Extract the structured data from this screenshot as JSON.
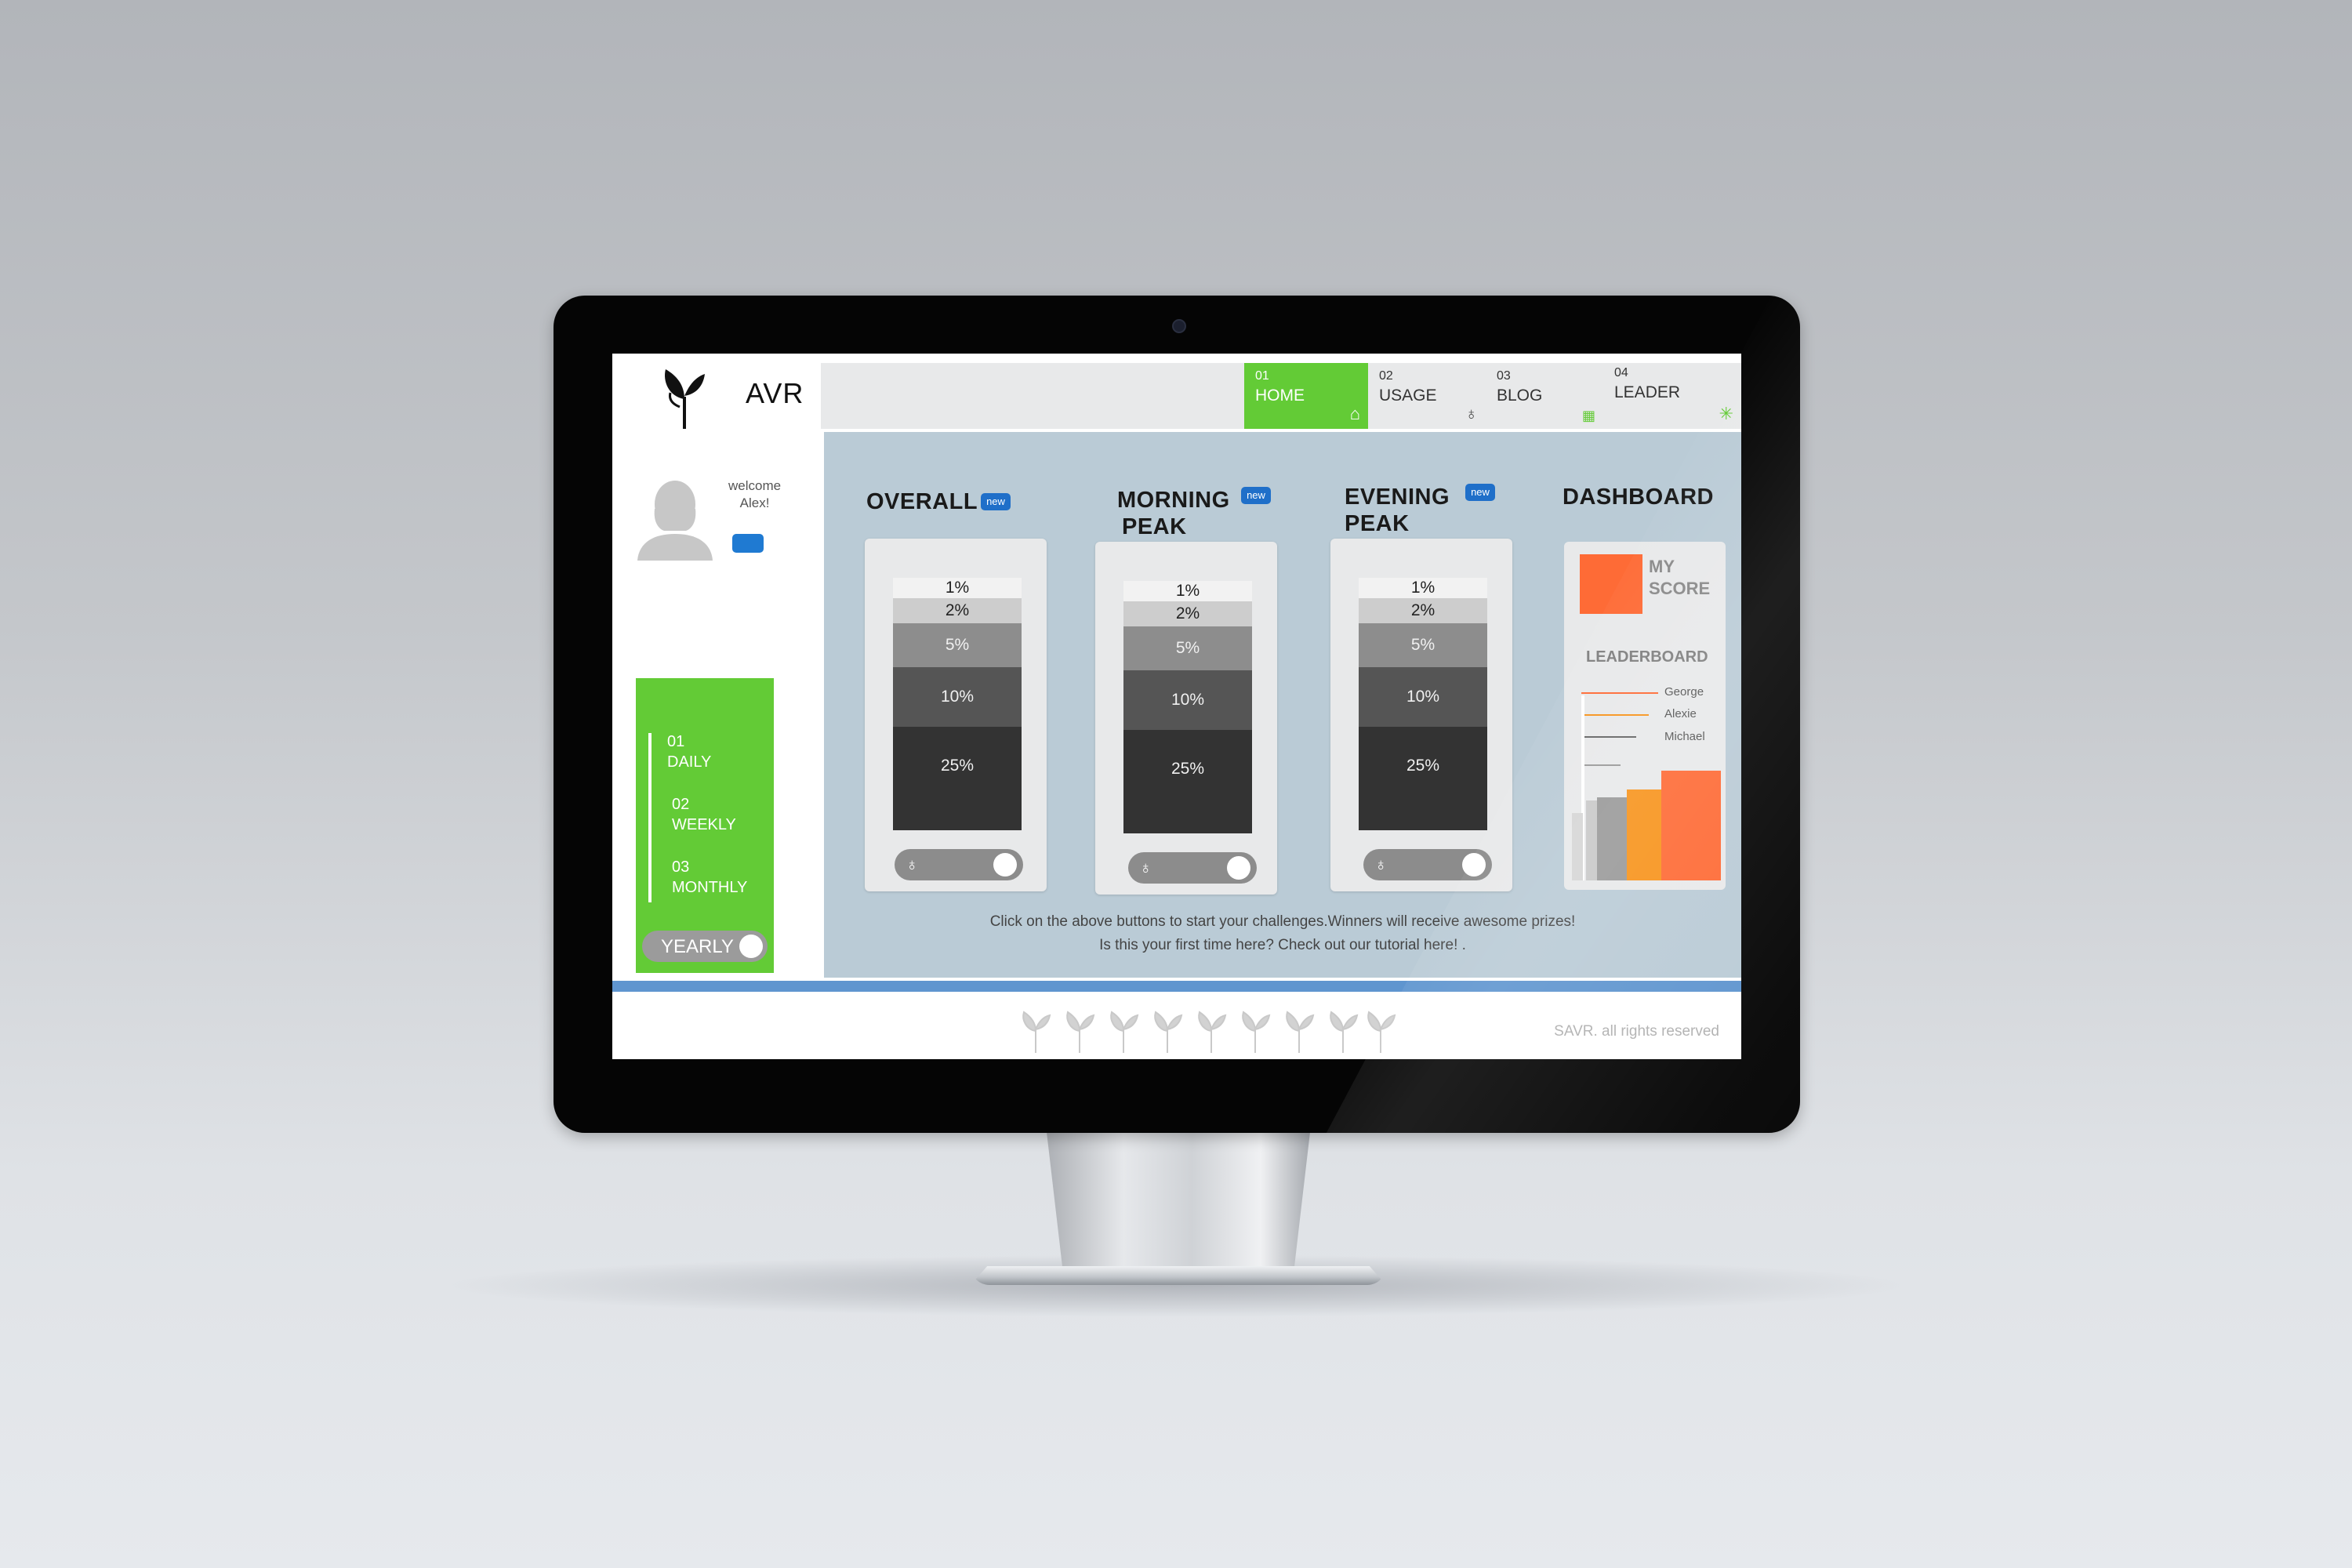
{
  "app": {
    "logo_text": "AVR"
  },
  "nav": {
    "items": [
      {
        "num": "01",
        "label": "HOME"
      },
      {
        "num": "02",
        "label": "USAGE"
      },
      {
        "num": "03",
        "label": "BLOG"
      },
      {
        "num": "04",
        "label": "LEADER"
      }
    ],
    "active": "HOME"
  },
  "user": {
    "welcome": "welcome",
    "name": "Alex!"
  },
  "periods": [
    {
      "num": "01",
      "label": "DAILY"
    },
    {
      "num": "02",
      "label": "WEEKLY"
    },
    {
      "num": "03",
      "label": "MONTHLY"
    }
  ],
  "yearly_label": "YEARLY",
  "challenges": [
    {
      "title_line1": "OVERALL",
      "title_line2": "",
      "badge": "new",
      "levels": [
        "1%",
        "2%",
        "5%",
        "10%",
        "25%"
      ]
    },
    {
      "title_line1": "MORNING",
      "title_line2": "PEAK",
      "badge": "new",
      "levels": [
        "1%",
        "2%",
        "5%",
        "10%",
        "25%"
      ]
    },
    {
      "title_line1": "EVENING",
      "title_line2": "PEAK",
      "badge": "new",
      "levels": [
        "1%",
        "2%",
        "5%",
        "10%",
        "25%"
      ]
    }
  ],
  "dashboard": {
    "title": "DASHBOARD",
    "my_score_line1": "MY",
    "my_score_line2": "SCORE",
    "leaderboard_title": "LEADERBOARD",
    "leaders": [
      {
        "name": "George",
        "color": "#fe6b36"
      },
      {
        "name": "Alexie",
        "color": "#f7941d"
      },
      {
        "name": "Michael",
        "color": "#666666"
      }
    ]
  },
  "footer": {
    "line1": "Click on the above buttons to start your challenges.Winners will receive awesome prizes!",
    "line2": "Is this your first time here? Check out our tutorial here! .",
    "copyright": "SAVR. all rights reserved"
  },
  "colors": {
    "green": "#63cb36",
    "blue": "#1f6fc9",
    "orange": "#fe6b36",
    "amber": "#f7941d",
    "panel": "#bacbd6"
  }
}
